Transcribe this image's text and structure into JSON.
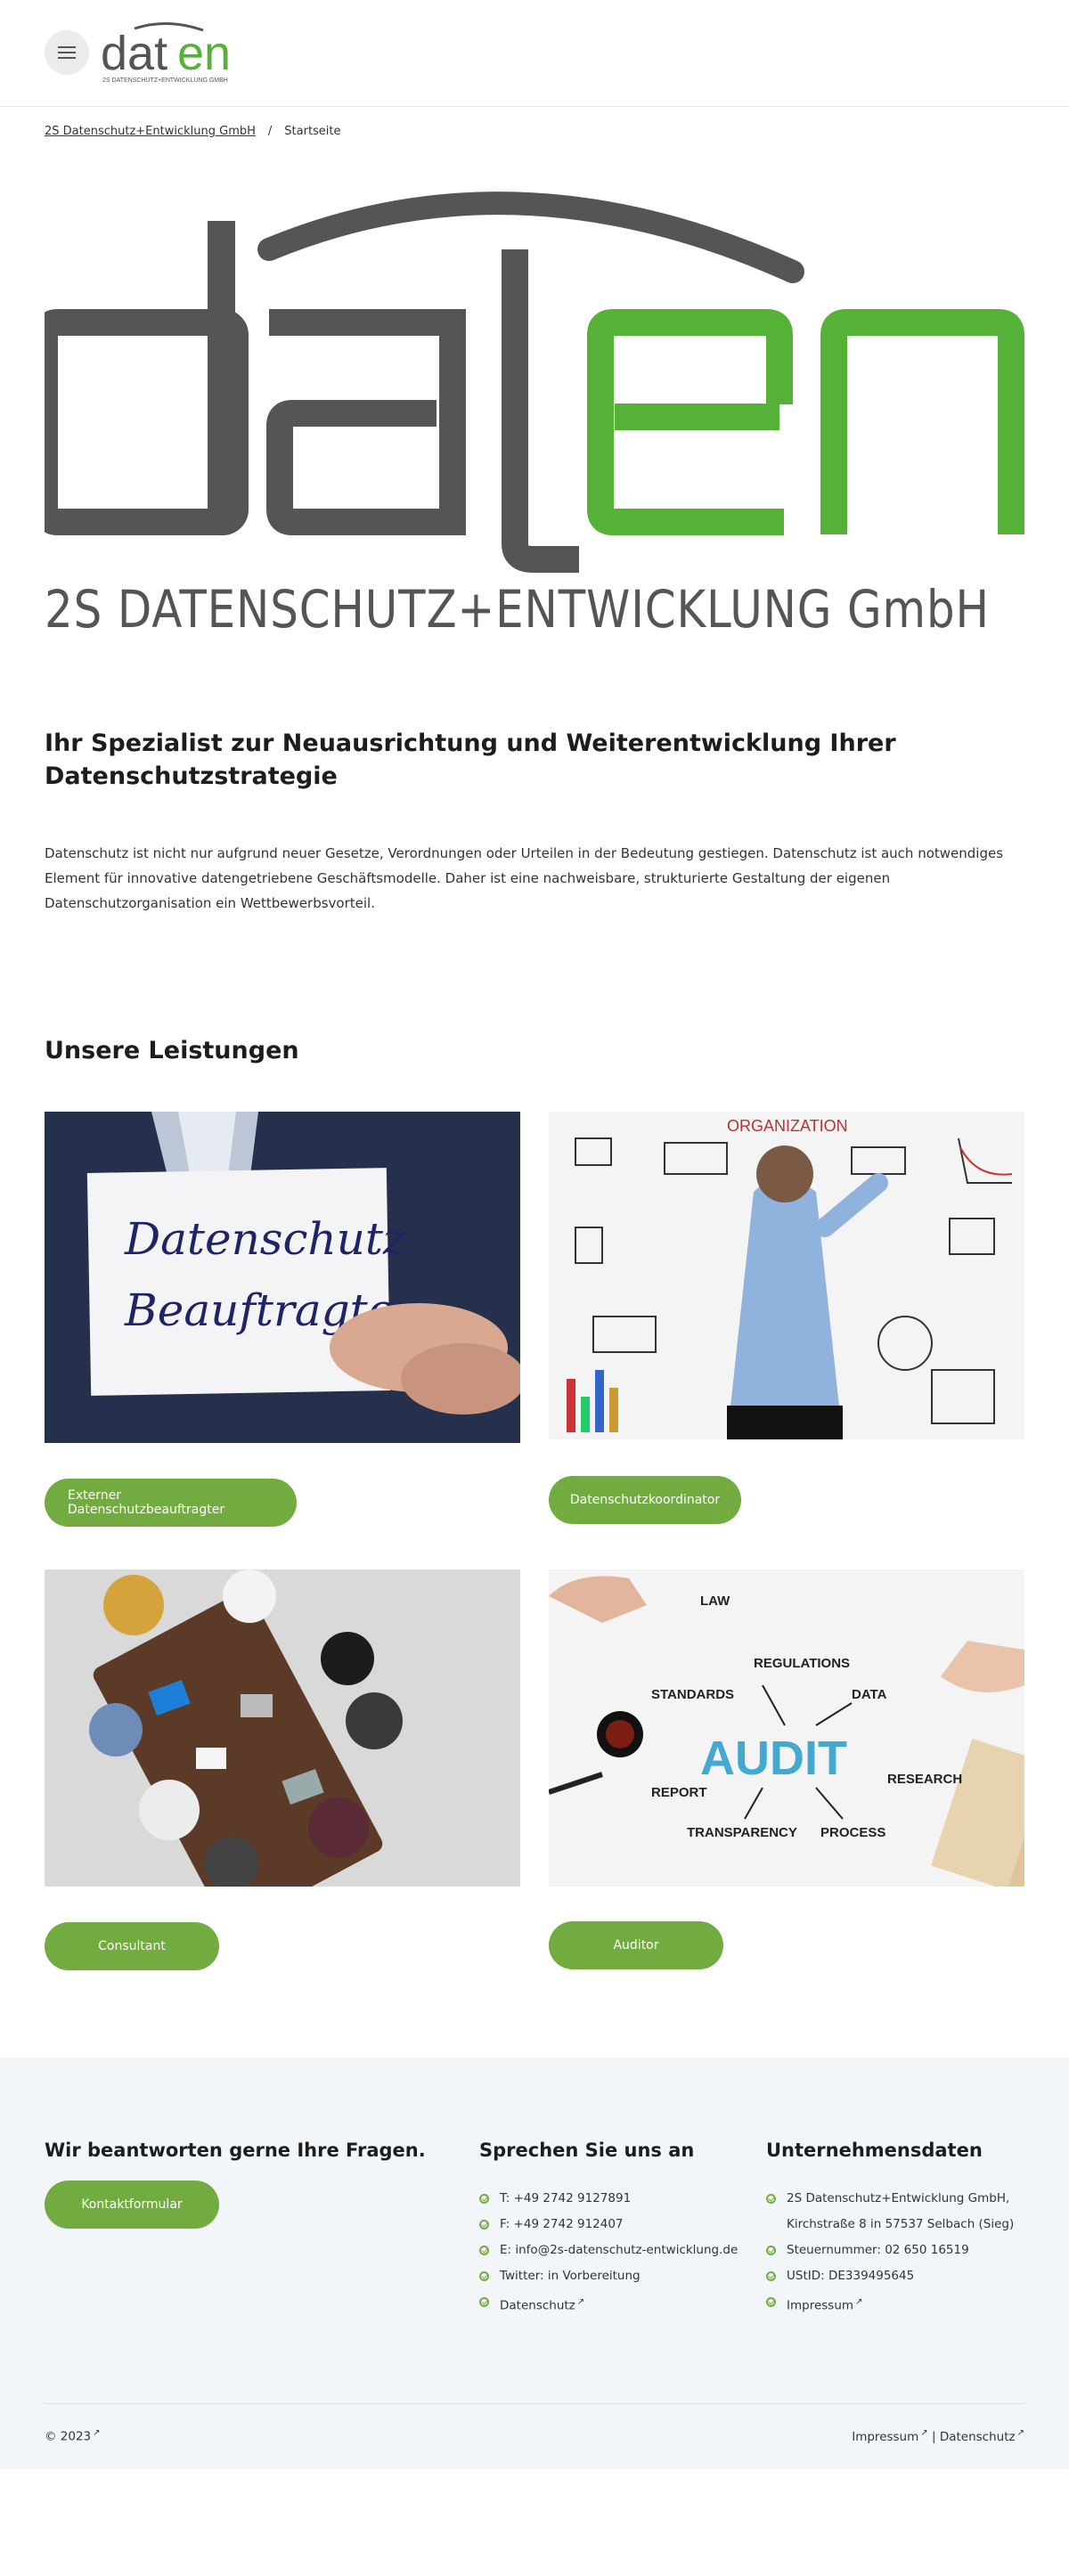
{
  "header": {
    "menu_icon": "hamburger-icon",
    "logo_word_left": "dat",
    "logo_word_right": "en",
    "logo_subtitle": "2S DATENSCHUTZ+ENTWICKLUNG GMBH"
  },
  "breadcrumb": {
    "home": "2S Datenschutz+Entwicklung GmbH",
    "separator": "/",
    "current": "Startseite"
  },
  "hero": {
    "logo_left": "dat",
    "logo_right": "en",
    "subtitle": "2S DATENSCHUTZ+ENTWICKLUNG GmbH",
    "logo_gray": "#555555",
    "logo_green": "#56b138"
  },
  "main": {
    "headline": "Ihr Spezialist zur Neuausrichtung und Weiterentwicklung Ihrer Datenschutzstrategie",
    "intro": "Datenschutz ist nicht nur aufgrund neuer Gesetze, Verordnungen oder Urteilen in der Bedeutung gestiegen. Datenschutz ist auch notwendiges Element für innovative datengetriebene Geschäftsmodelle.  Daher ist eine nachweisbare, strukturierte Gestaltung der eigenen Datenschutzorganisation ein Wettbewerbsvorteil.",
    "services_title": "Unsere Leistungen",
    "services": [
      {
        "label": "Externer Datenschutzbeauftragter",
        "image_text_1": "Datenschutz",
        "image_text_2": "Beauftragter"
      },
      {
        "label": "Datenschutzkoordinator",
        "image_text": "ORGANIZATION"
      },
      {
        "label": "Consultant"
      },
      {
        "label": "Auditor",
        "image_text": "AUDIT",
        "words": [
          "LAW",
          "REGULATIONS",
          "STANDARDS",
          "DATA",
          "REPORT",
          "RESEARCH",
          "TRANSPARENCY",
          "PROCESS"
        ]
      }
    ]
  },
  "footer": {
    "contact_title": "Wir beantworten gerne Ihre Fragen.",
    "contact_button": "Kontaktformular",
    "talk_title": "Sprechen Sie uns an",
    "talk_items": [
      "T: +49 2742 9127891",
      "F: +49 2742 912407",
      "E: info@2s-datenschutz-entwicklung.de",
      "Twitter: in Vorbereitung",
      "Datenschutz"
    ],
    "company_title": "Unternehmensdaten",
    "company_items": [
      "2S Datenschutz+Entwicklung GmbH, Kirchstraße 8 in 57537 Selbach (Sieg)",
      "Steuernummer: 02 650 16519",
      "UStID: DE339495645",
      "Impressum"
    ],
    "copyright": "© 2023",
    "legal_impressum": "Impressum",
    "legal_sep": "|",
    "legal_datenschutz": "Datenschutz",
    "accent": "#72ab3f",
    "background": "#f3f6f9"
  }
}
